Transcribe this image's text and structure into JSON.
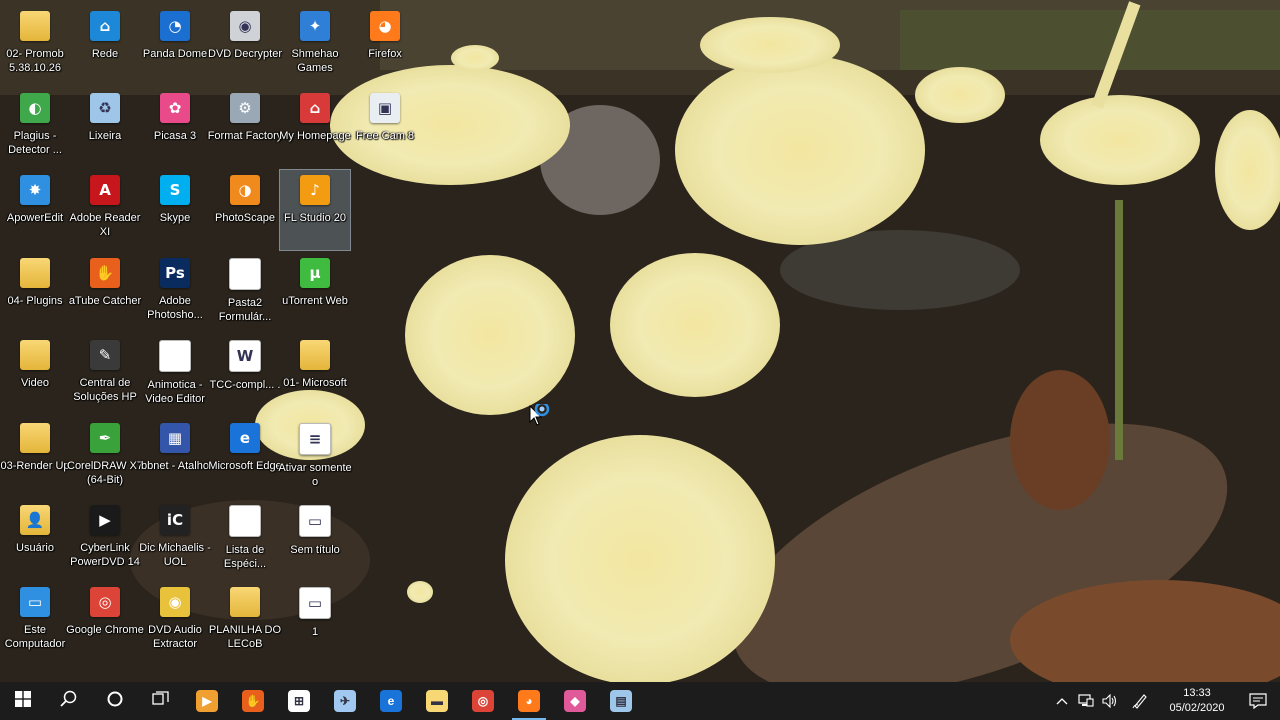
{
  "desktop": {
    "icons": [
      {
        "label": "02- Promob 5.38.10.26",
        "icon": "folder-icon",
        "color": "#e4b53a"
      },
      {
        "label": "Rede",
        "icon": "network-icon",
        "color": "#1e88d8"
      },
      {
        "label": "Panda Dome",
        "icon": "panda-dome-icon",
        "color": "#1a6fd1"
      },
      {
        "label": "DVD Decrypter",
        "icon": "dvd-disc-icon",
        "color": "#cfd3d8"
      },
      {
        "label": "Shmehao Games",
        "icon": "games-icon",
        "color": "#2f7fd6"
      },
      {
        "label": "Firefox",
        "icon": "firefox-icon",
        "color": "#ff7a1a"
      },
      {
        "label": "Plagius - Detector ...",
        "icon": "plagius-icon",
        "color": "#3fa84a"
      },
      {
        "label": "Lixeira",
        "icon": "recycle-bin-icon",
        "color": "#9ec6e8"
      },
      {
        "label": "Picasa 3",
        "icon": "picasa-icon",
        "color": "#e94b8a"
      },
      {
        "label": "Format Factory",
        "icon": "format-factory-icon",
        "color": "#9aa7b5"
      },
      {
        "label": "My Homepage",
        "icon": "homepage-icon",
        "color": "#d83a3a"
      },
      {
        "label": "Free Cam 8",
        "icon": "free-cam-icon",
        "color": "#e9eef3"
      },
      {
        "label": "ApowerEdit",
        "icon": "apoweredit-icon",
        "color": "#2f8fe0"
      },
      {
        "label": "Adobe Reader XI",
        "icon": "adobe-reader-icon",
        "color": "#c8161d"
      },
      {
        "label": "Skype",
        "icon": "skype-icon",
        "color": "#00aff0"
      },
      {
        "label": "PhotoScape",
        "icon": "photoscape-icon",
        "color": "#f08a1c"
      },
      {
        "label": "FL Studio 20",
        "icon": "fl-studio-icon",
        "color": "#f39c12"
      },
      {
        "label": "04- Plugins",
        "icon": "folder-icon",
        "color": "#e4b53a"
      },
      {
        "label": "aTube Catcher",
        "icon": "atube-catcher-icon",
        "color": "#e8601c"
      },
      {
        "label": "Adobe Photosho...",
        "icon": "photoshop-icon",
        "color": "#0a2b5e"
      },
      {
        "label": "Pasta2 Formulár...",
        "icon": "document-icon",
        "color": "#ffffff"
      },
      {
        "label": "uTorrent Web",
        "icon": "utorrent-icon",
        "color": "#3fbb3f"
      },
      {
        "label": "Video",
        "icon": "folder-icon",
        "color": "#e4b53a"
      },
      {
        "label": "Central de Soluções HP",
        "icon": "hp-solutions-icon",
        "color": "#3a3a3a"
      },
      {
        "label": "Animotica - Video Editor",
        "icon": "document-icon",
        "color": "#ffffff"
      },
      {
        "label": "TCC-compl... .",
        "icon": "docx-file-icon",
        "color": "#ffffff"
      },
      {
        "label": "01- Microsoft",
        "icon": "folder-icon",
        "color": "#e4b53a"
      },
      {
        "label": "03-Render Up",
        "icon": "folder-icon",
        "color": "#e4b53a"
      },
      {
        "label": "CorelDRAW X7 (64-Bit)",
        "icon": "coreldraw-icon",
        "color": "#3aa23a"
      },
      {
        "label": "bbnet - Atalho",
        "icon": "bbnet-icon",
        "color": "#3355aa"
      },
      {
        "label": "Microsoft Edge",
        "icon": "edge-icon",
        "color": "#1a73d8"
      },
      {
        "label": "Ativar somente o",
        "icon": "text-file-icon",
        "color": "#ffffff"
      },
      {
        "label": "Usuário",
        "icon": "user-folder-icon",
        "color": "#e4b53a"
      },
      {
        "label": "CyberLink PowerDVD 14",
        "icon": "powerdvd-icon",
        "color": "#1a1a1a"
      },
      {
        "label": "Dic Michaelis - UOL",
        "icon": "michaelis-icon",
        "color": "#222222"
      },
      {
        "label": "Lista de Espéci...",
        "icon": "document-icon",
        "color": "#ffffff"
      },
      {
        "label": "Sem título",
        "icon": "image-file-icon",
        "color": "#ffffff"
      },
      {
        "label": "Este Computador",
        "icon": "computer-icon",
        "color": "#2f8fe0"
      },
      {
        "label": "Google Chrome",
        "icon": "chrome-icon",
        "color": "#db4437"
      },
      {
        "label": "DVD Audio Extractor",
        "icon": "dvd-audio-icon",
        "color": "#e8c23a"
      },
      {
        "label": "PLANILHA DO LECoB",
        "icon": "folder-icon",
        "color": "#e4b53a"
      },
      {
        "label": "1",
        "icon": "image-file-icon",
        "color": "#ffffff"
      }
    ]
  },
  "taskbar": {
    "apps": [
      {
        "name": "start-button",
        "icon": "windows-logo-icon"
      },
      {
        "name": "search-button",
        "icon": "search-icon"
      },
      {
        "name": "cortana-button",
        "icon": "cortana-icon"
      },
      {
        "name": "task-view-button",
        "icon": "task-view-icon"
      },
      {
        "name": "taskbar-app",
        "icon": "video-player-icon",
        "color": "#f0a030"
      },
      {
        "name": "taskbar-app",
        "icon": "atube-catcher-icon",
        "color": "#e8601c"
      },
      {
        "name": "taskbar-app",
        "icon": "microsoft-store-icon",
        "color": "#ffffff"
      },
      {
        "name": "taskbar-app",
        "icon": "rocket-icon",
        "color": "#a0c8f0"
      },
      {
        "name": "taskbar-app",
        "icon": "edge-icon",
        "color": "#1a73d8"
      },
      {
        "name": "taskbar-app",
        "icon": "file-explorer-icon",
        "color": "#f8d775"
      },
      {
        "name": "taskbar-app",
        "icon": "chrome-icon",
        "color": "#db4437"
      },
      {
        "name": "taskbar-app",
        "icon": "firefox-icon",
        "color": "#ff7a1a",
        "active": true
      },
      {
        "name": "taskbar-app",
        "icon": "maps-pin-icon",
        "color": "#e05a9a"
      },
      {
        "name": "taskbar-app",
        "icon": "notepad-icon",
        "color": "#9ec6e8"
      }
    ],
    "tray": {
      "time": "13:33",
      "date": "05/02/2020",
      "icons": [
        "chevron-up-icon",
        "network-icon",
        "volume-icon",
        "pen-icon"
      ]
    }
  }
}
